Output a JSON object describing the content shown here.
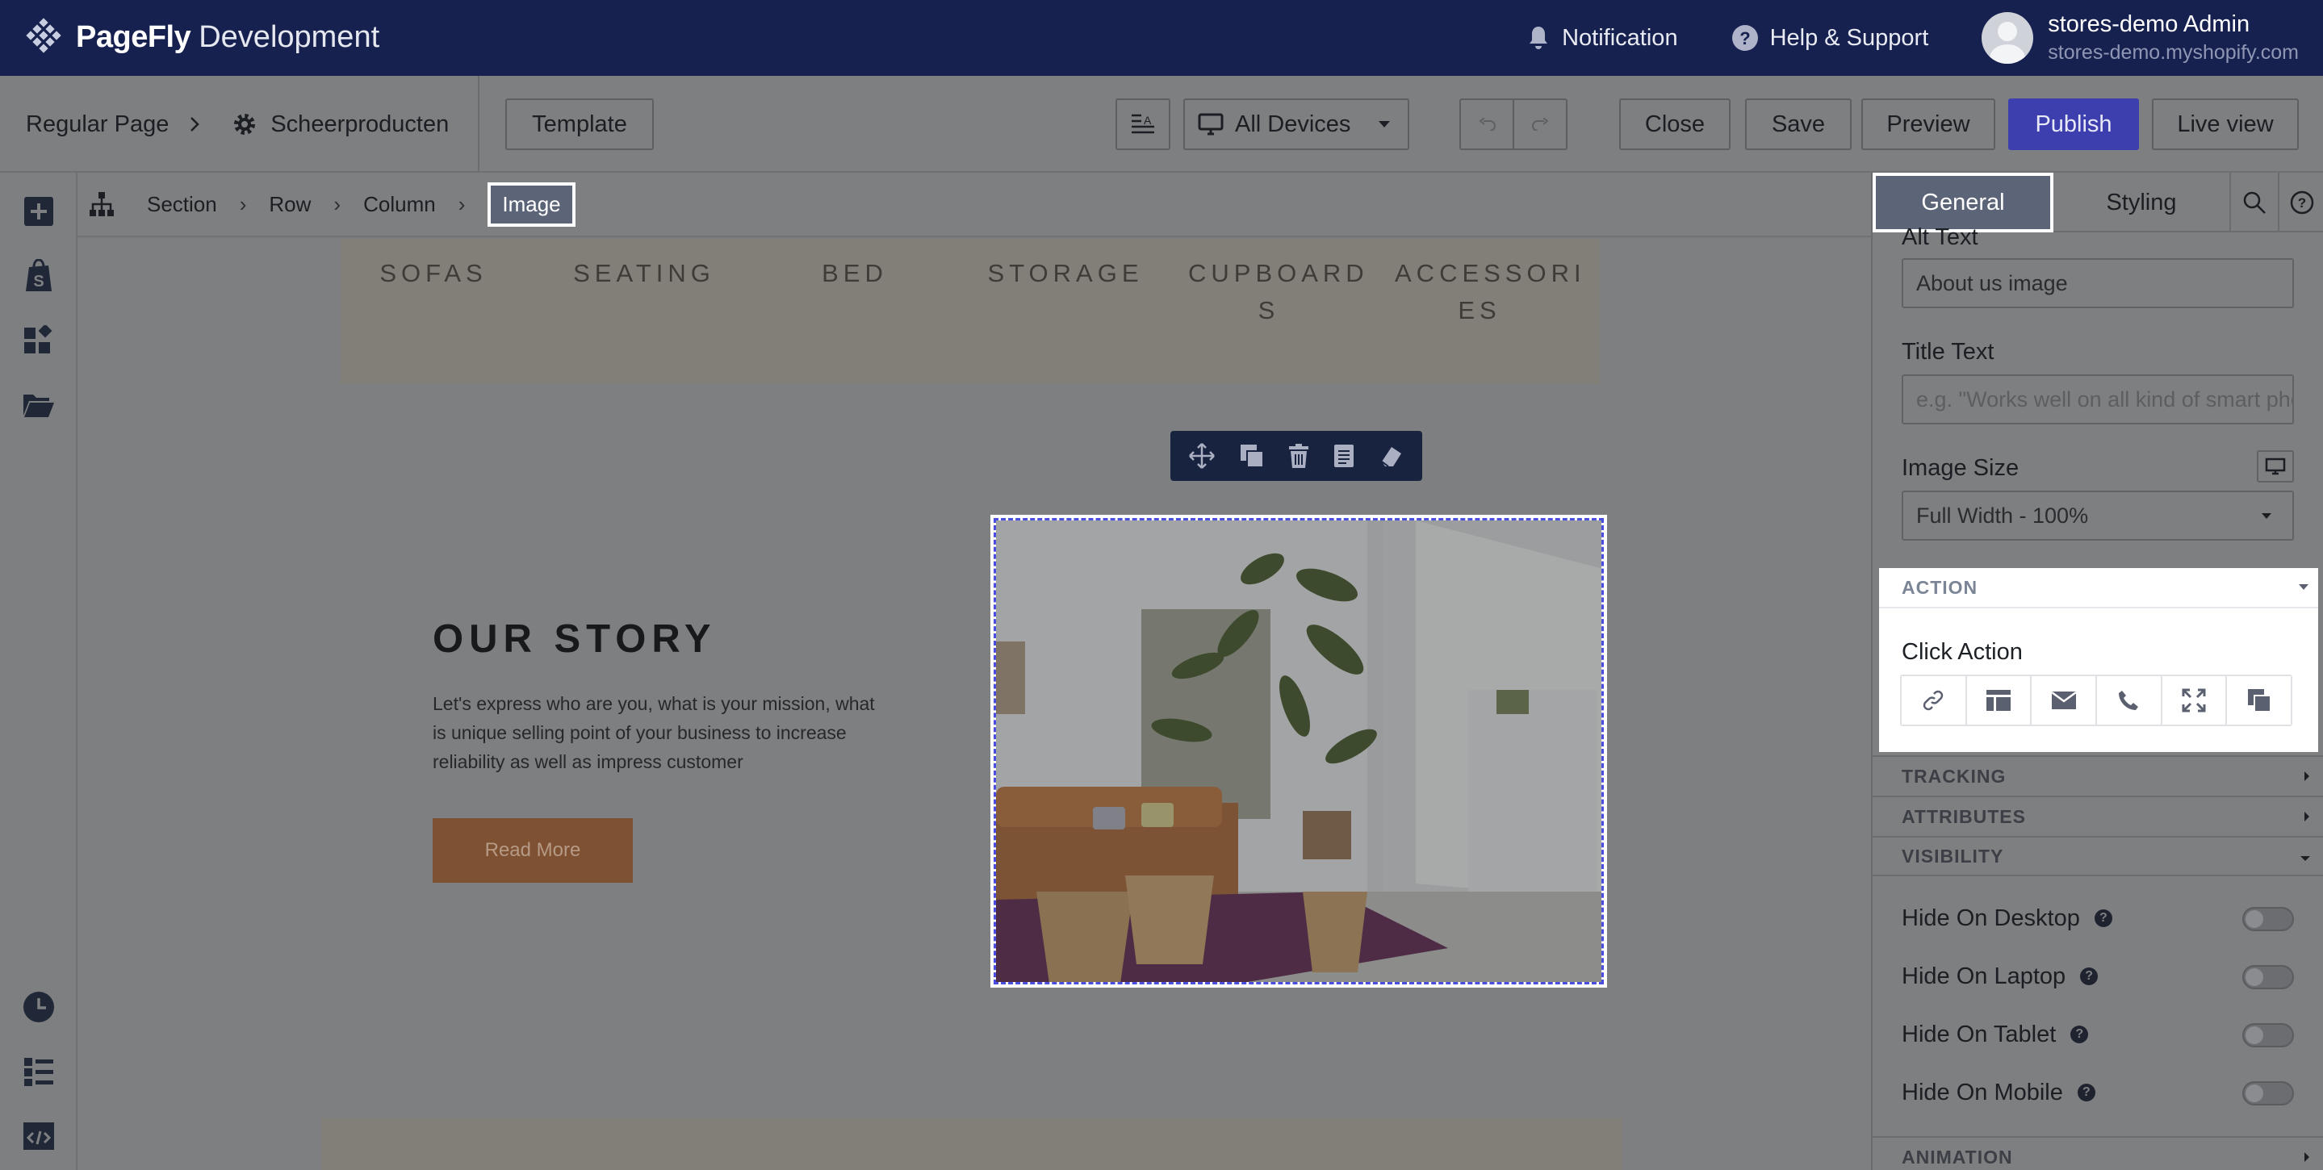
{
  "topbar": {
    "brand": "PageFly",
    "env": "Development",
    "notification": "Notification",
    "help": "Help & Support",
    "account_name": "stores-demo Admin",
    "account_store": "stores-demo.myshopify.com"
  },
  "toolbar": {
    "page_type": "Regular Page",
    "page_name": "Scheerproducten",
    "template": "Template",
    "devices": "All Devices",
    "close": "Close",
    "save": "Save",
    "preview": "Preview",
    "publish": "Publish",
    "live_view": "Live view"
  },
  "breadcrumb": {
    "items": [
      "Section",
      "Row",
      "Column"
    ],
    "active": "Image"
  },
  "canvas": {
    "nav_items": [
      "SOFAS",
      "SEATING",
      "BED",
      "STORAGE",
      "CUPBOARD S",
      "ACCESSORI ES"
    ],
    "story_title": "OUR STORY",
    "story_text": "Let's express who are you, what is your mission, what is unique selling point of your business to increase reliability as well as impress customer",
    "read_more": "Read More"
  },
  "panel": {
    "tabs": [
      "General",
      "Styling"
    ],
    "alt_text_label": "Alt Text",
    "alt_text_value": "About us image",
    "title_text_label": "Title Text",
    "title_text_placeholder": "e.g. \"Works well on all kind of smart phones\"",
    "image_size_label": "Image Size",
    "image_size_value": "Full Width - 100%",
    "sections": {
      "action": "ACTION",
      "tracking": "TRACKING",
      "attributes": "ATTRIBUTES",
      "visibility": "VISIBILITY",
      "animation": "ANIMATION"
    },
    "click_action_label": "Click Action",
    "visibility_options": [
      "Hide On Desktop",
      "Hide On Laptop",
      "Hide On Tablet",
      "Hide On Mobile"
    ]
  },
  "colors": {
    "topbar_bg": "#172150",
    "publish": "#3d3fae",
    "selection_dash": "#4a4ee0",
    "read_more_bg": "#7f5133"
  },
  "icons": {
    "rail_top": [
      "plus-box-icon",
      "shopify-bag-icon",
      "widgets-icon",
      "folder-open-icon"
    ],
    "rail_bottom": [
      "history-icon",
      "list-icon",
      "code-icon"
    ],
    "image_toolbar": [
      "move-icon",
      "duplicate-icon",
      "delete-icon",
      "copy-icon",
      "eraser-icon"
    ],
    "click_actions": [
      "link-icon",
      "page-icon",
      "email-icon",
      "phone-icon",
      "fullscreen-icon",
      "popup-icon"
    ]
  }
}
